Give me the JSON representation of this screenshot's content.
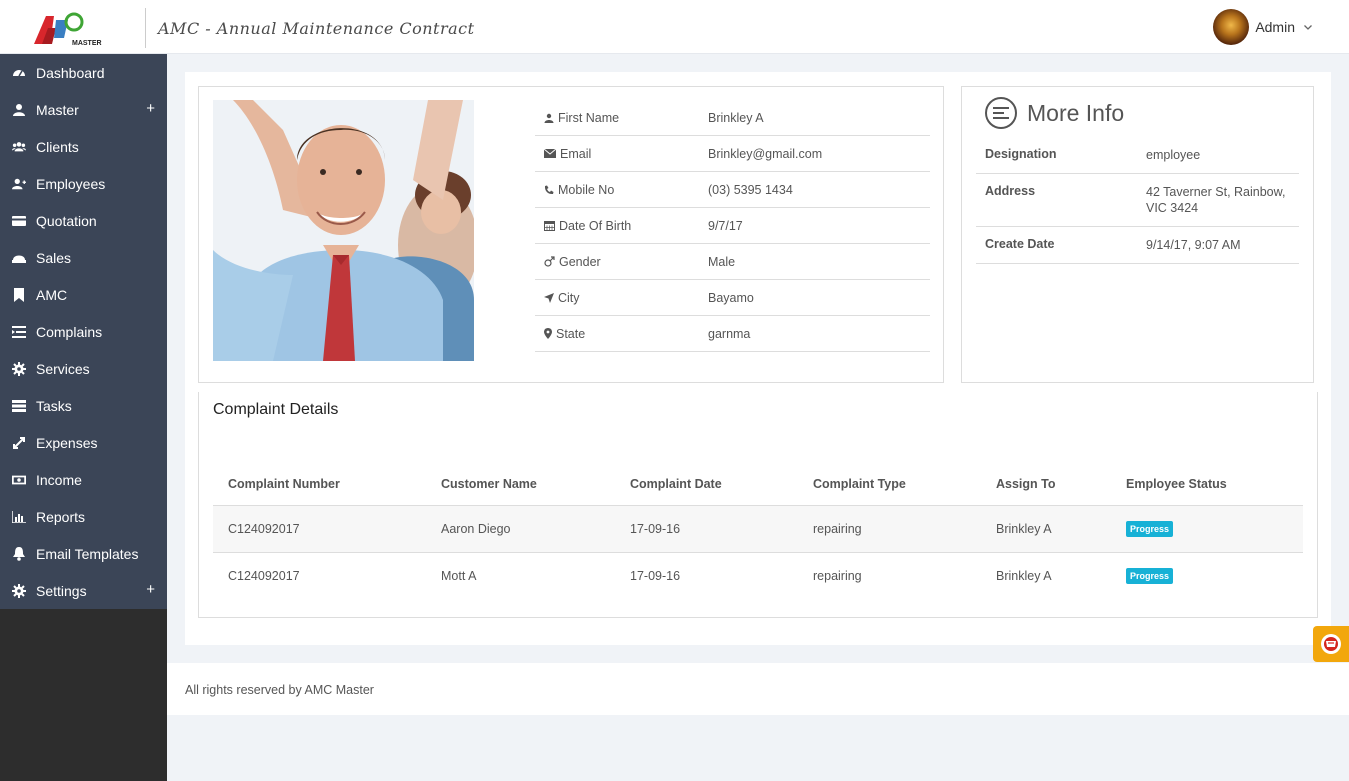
{
  "header": {
    "logo_text": "AMC MASTER",
    "title": "AMC - Annual Maintenance Contract",
    "user_name": "Admin"
  },
  "sidebar": {
    "items": [
      {
        "label": "Dashboard",
        "icon": "dashboard-icon",
        "has_plus": false
      },
      {
        "label": "Master",
        "icon": "user-icon",
        "has_plus": true
      },
      {
        "label": "Clients",
        "icon": "users-icon",
        "has_plus": false
      },
      {
        "label": "Employees",
        "icon": "user-plus-icon",
        "has_plus": false
      },
      {
        "label": "Quotation",
        "icon": "credit-card-icon",
        "has_plus": false
      },
      {
        "label": "Sales",
        "icon": "sales-icon",
        "has_plus": false
      },
      {
        "label": "AMC",
        "icon": "bookmark-icon",
        "has_plus": false
      },
      {
        "label": "Complains",
        "icon": "list-icon",
        "has_plus": false
      },
      {
        "label": "Services",
        "icon": "cog-icon",
        "has_plus": false
      },
      {
        "label": "Tasks",
        "icon": "tasks-icon",
        "has_plus": false
      },
      {
        "label": "Expenses",
        "icon": "expand-icon",
        "has_plus": false
      },
      {
        "label": "Income",
        "icon": "money-icon",
        "has_plus": false
      },
      {
        "label": "Reports",
        "icon": "bar-chart-icon",
        "has_plus": false
      },
      {
        "label": "Email Templates",
        "icon": "bell-icon",
        "has_plus": false
      },
      {
        "label": "Settings",
        "icon": "gear-icon",
        "has_plus": true
      }
    ],
    "plus_symbol": "+"
  },
  "profile": {
    "fields": [
      {
        "label": "First Name",
        "value": "Brinkley A",
        "icon": "user-icon"
      },
      {
        "label": "Email",
        "value": "Brinkley@gmail.com",
        "icon": "envelope-icon"
      },
      {
        "label": "Mobile No",
        "value": "(03) 5395 1434",
        "icon": "phone-icon"
      },
      {
        "label": "Date Of Birth",
        "value": "9/7/17",
        "icon": "calendar-icon"
      },
      {
        "label": "Gender",
        "value": "Male",
        "icon": "mars-icon"
      },
      {
        "label": "City",
        "value": "Bayamo",
        "icon": "location-arrow-icon"
      },
      {
        "label": "State",
        "value": "garnma",
        "icon": "map-marker-icon"
      }
    ]
  },
  "more_info": {
    "title": "More Info",
    "rows": [
      {
        "label": "Designation",
        "value": "employee"
      },
      {
        "label": "Address",
        "value": "42 Taverner St, Rainbow, VIC 3424"
      },
      {
        "label": "Create Date",
        "value": "9/14/17, 9:07 AM"
      }
    ]
  },
  "complaints": {
    "title": "Complaint Details",
    "columns": [
      "Complaint Number",
      "Customer Name",
      "Complaint Date",
      "Complaint Type",
      "Assign To",
      "Employee Status"
    ],
    "rows": [
      {
        "number": "C124092017",
        "customer": "Aaron Diego",
        "date": "17-09-16",
        "type": "repairing",
        "assign": "Brinkley A",
        "status": "Progress"
      },
      {
        "number": "C124092017",
        "customer": "Mott A",
        "date": "17-09-16",
        "type": "repairing",
        "assign": "Brinkley A",
        "status": "Progress"
      }
    ]
  },
  "footer": {
    "text": "All rights reserved by AMC Master"
  },
  "colors": {
    "sidebar_bg": "#3b4557",
    "badge": "#17b1d6",
    "floating_button": "#f2a70c"
  }
}
